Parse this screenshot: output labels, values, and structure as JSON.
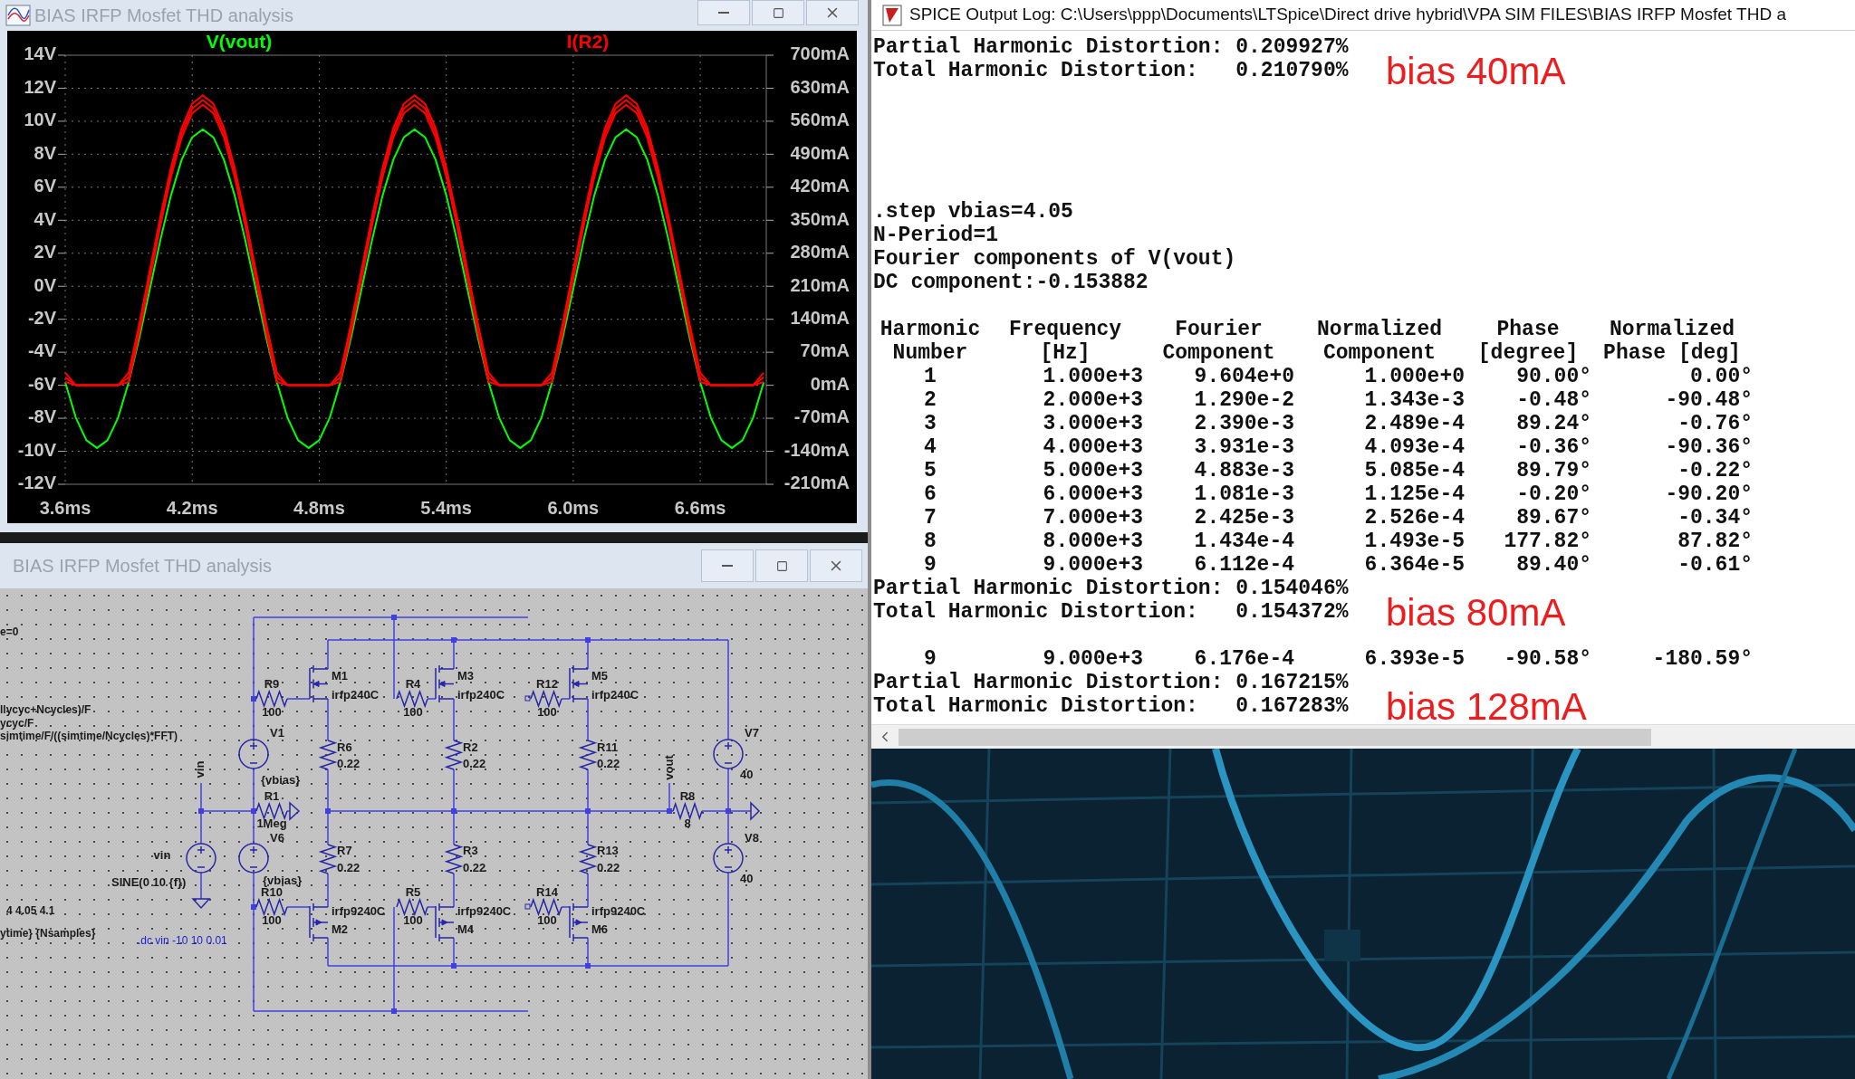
{
  "plot_window": {
    "title": "BIAS IRFP Mosfet THD analysis",
    "chart_data": {
      "type": "line",
      "grid": true,
      "xlim": [
        3.6,
        6.912
      ],
      "ylim": [
        -12,
        14
      ],
      "y2lim": [
        -210,
        700
      ],
      "xticks": [
        {
          "value": 3.6,
          "label": "3.6ms"
        },
        {
          "value": 4.2,
          "label": "4.2ms"
        },
        {
          "value": 4.8,
          "label": "4.8ms"
        },
        {
          "value": 5.4,
          "label": "5.4ms"
        },
        {
          "value": 6.0,
          "label": "6.0ms"
        },
        {
          "value": 6.6,
          "label": "6.6ms"
        }
      ],
      "yticks": [
        {
          "value": 14,
          "label": "14V"
        },
        {
          "value": 12,
          "label": "12V"
        },
        {
          "value": 10,
          "label": "10V"
        },
        {
          "value": 8,
          "label": "8V"
        },
        {
          "value": 6,
          "label": "6V"
        },
        {
          "value": 4,
          "label": "4V"
        },
        {
          "value": 2,
          "label": "2V"
        },
        {
          "value": 0,
          "label": "0V"
        },
        {
          "value": -2,
          "label": "-2V"
        },
        {
          "value": -4,
          "label": "-4V"
        },
        {
          "value": -6,
          "label": "-6V"
        },
        {
          "value": -8,
          "label": "-8V"
        },
        {
          "value": -10,
          "label": "-10V"
        },
        {
          "value": -12,
          "label": "-12V"
        }
      ],
      "y2ticks": [
        {
          "value": 700,
          "label": "700mA"
        },
        {
          "value": 630,
          "label": "630mA"
        },
        {
          "value": 560,
          "label": "560mA"
        },
        {
          "value": 490,
          "label": "490mA"
        },
        {
          "value": 420,
          "label": "420mA"
        },
        {
          "value": 350,
          "label": "350mA"
        },
        {
          "value": 280,
          "label": "280mA"
        },
        {
          "value": 210,
          "label": "210mA"
        },
        {
          "value": 140,
          "label": "140mA"
        },
        {
          "value": 70,
          "label": "70mA"
        },
        {
          "value": 0,
          "label": "0mA"
        },
        {
          "value": -70,
          "label": "-70mA"
        },
        {
          "value": -140,
          "label": "-140mA"
        },
        {
          "value": -210,
          "label": "-210mA"
        }
      ],
      "x": [
        3.6,
        3.65,
        3.7,
        3.75,
        3.8,
        3.85,
        3.9,
        3.95,
        4.0,
        4.05,
        4.1,
        4.15,
        4.2,
        4.25,
        4.3,
        4.35,
        4.4,
        4.45,
        4.5,
        4.55,
        4.6,
        4.65,
        4.7,
        4.75,
        4.8,
        4.85,
        4.9,
        4.95,
        5.0,
        5.05,
        5.1,
        5.15,
        5.2,
        5.25,
        5.3,
        5.35,
        5.4,
        5.45,
        5.5,
        5.55,
        5.6,
        5.65,
        5.7,
        5.75,
        5.8,
        5.85,
        5.9,
        5.95,
        6.0,
        6.05,
        6.1,
        6.15,
        6.2,
        6.25,
        6.3,
        6.35,
        6.4,
        6.45,
        6.5,
        6.55,
        6.6,
        6.65,
        6.7,
        6.75,
        6.8,
        6.85,
        6.9
      ],
      "series": [
        {
          "name": "V(vout)",
          "color": "#00ff00",
          "values": [
            -5.82,
            -7.96,
            -9.33,
            -9.8,
            -9.33,
            -7.96,
            -5.82,
            -3.13,
            -0.15,
            2.83,
            5.52,
            7.66,
            9.03,
            9.5,
            9.03,
            7.66,
            5.52,
            2.83,
            -0.15,
            -3.13,
            -5.82,
            -7.96,
            -9.33,
            -9.8,
            -9.33,
            -7.96,
            -5.82,
            -3.13,
            -0.15,
            2.83,
            5.52,
            7.66,
            9.03,
            9.5,
            9.03,
            7.66,
            5.52,
            2.83,
            -0.15,
            -3.13,
            -5.82,
            -7.96,
            -9.33,
            -9.8,
            -9.33,
            -7.96,
            -5.82,
            -3.13,
            -0.15,
            2.83,
            5.52,
            7.66,
            9.03,
            9.5,
            9.03,
            7.66,
            5.52,
            2.83,
            -0.15,
            -3.13,
            -5.82,
            -7.96,
            -9.33,
            -9.8,
            -9.33,
            -7.96,
            -5.82
          ]
        },
        {
          "name": "I(R2)",
          "color": "#ff0000",
          "axis": "y2",
          "values": [
            7,
            0,
            0,
            0,
            0,
            0,
            7,
            110,
            225,
            339,
            442,
            525,
            577,
            595,
            577,
            525,
            442,
            339,
            225,
            110,
            7,
            0,
            0,
            0,
            0,
            0,
            7,
            110,
            225,
            339,
            442,
            525,
            577,
            595,
            577,
            525,
            442,
            339,
            225,
            110,
            7,
            0,
            0,
            0,
            0,
            0,
            7,
            110,
            225,
            339,
            442,
            525,
            577,
            595,
            577,
            525,
            442,
            339,
            225,
            110,
            7,
            0,
            0,
            0,
            0,
            0,
            7
          ]
        },
        {
          "color": "#ff0000",
          "axis": "y2",
          "values": [
            17,
            0,
            0,
            0,
            0,
            0,
            17,
            120,
            235,
            349,
            452,
            535,
            587,
            605,
            587,
            535,
            452,
            349,
            235,
            120,
            17,
            0,
            0,
            0,
            0,
            0,
            17,
            120,
            235,
            349,
            452,
            535,
            587,
            605,
            587,
            535,
            452,
            349,
            235,
            120,
            17,
            0,
            0,
            0,
            0,
            0,
            17,
            120,
            235,
            349,
            452,
            535,
            587,
            605,
            587,
            535,
            452,
            349,
            235,
            120,
            17,
            0,
            0,
            0,
            0,
            0,
            17
          ]
        },
        {
          "color": "#ff0000",
          "axis": "y2",
          "values": [
            27,
            0,
            0,
            0,
            0,
            0,
            27,
            130,
            245,
            359,
            462,
            545,
            597,
            615,
            597,
            545,
            462,
            359,
            245,
            130,
            27,
            0,
            0,
            0,
            0,
            0,
            27,
            130,
            245,
            359,
            462,
            545,
            597,
            615,
            597,
            545,
            462,
            359,
            245,
            130,
            27,
            0,
            0,
            0,
            0,
            0,
            27,
            130,
            245,
            359,
            462,
            545,
            597,
            615,
            597,
            545,
            462,
            359,
            245,
            130,
            27,
            0,
            0,
            0,
            0,
            0,
            27
          ]
        }
      ]
    }
  },
  "schematic_window": {
    "title": "BIAS IRFP Mosfet THD analysis",
    "directives": [
      {
        "kind": "directive",
        "text": "e=0"
      },
      {
        "kind": "directive",
        "text": "llycyc+Ncycles)/F"
      },
      {
        "kind": "directive",
        "text": "ycyc/F"
      },
      {
        "kind": "directive",
        "text": "simtime/F/((simtime/Ncycles)*FFT)"
      },
      {
        "kind": "directive",
        "text": "4 4.05 4.1"
      },
      {
        "kind": "directive",
        "text": "ytime} {Nsamples}"
      },
      {
        "kind": "comment",
        "text": ".dc vin -10 10 0.01"
      }
    ],
    "components": [
      {
        "kind": "resistor",
        "ref": "R9",
        "value": "100"
      },
      {
        "kind": "mosfet",
        "ref": "M1",
        "value": "irfp240C"
      },
      {
        "kind": "resistor",
        "ref": "R4",
        "value": "100"
      },
      {
        "kind": "mosfet",
        "ref": "M3",
        "value": "irfp240C"
      },
      {
        "kind": "resistor",
        "ref": "R12",
        "value": "100"
      },
      {
        "kind": "mosfet",
        "ref": "M5",
        "value": "irfp240C"
      },
      {
        "kind": "source",
        "ref": "V1",
        "value": "{vbias}"
      },
      {
        "kind": "resistor",
        "ref": "R6",
        "value": "0.22"
      },
      {
        "kind": "resistor",
        "ref": "R2",
        "value": "0.22"
      },
      {
        "kind": "resistor",
        "ref": "R11",
        "value": "0.22"
      },
      {
        "kind": "source",
        "ref": "V7",
        "value": "40"
      },
      {
        "kind": "resistor",
        "ref": "R1",
        "value": "1Meg"
      },
      {
        "kind": "resistor",
        "ref": "R8",
        "value": "8"
      },
      {
        "kind": "source",
        "ref": "vin",
        "value": "SINE(0 10 {f})"
      },
      {
        "kind": "source",
        "ref": "V6",
        "value": "{vbias}"
      },
      {
        "kind": "resistor",
        "ref": "R7",
        "value": "0.22"
      },
      {
        "kind": "resistor",
        "ref": "R3",
        "value": "0.22"
      },
      {
        "kind": "resistor",
        "ref": "R13",
        "value": "0.22"
      },
      {
        "kind": "source",
        "ref": "V8",
        "value": "40"
      },
      {
        "kind": "resistor",
        "ref": "R10",
        "value": "100"
      },
      {
        "kind": "mosfet",
        "ref": "M2",
        "value": "irfp9240C"
      },
      {
        "kind": "resistor",
        "ref": "R5",
        "value": "100"
      },
      {
        "kind": "mosfet",
        "ref": "M4",
        "value": "irfp9240C"
      },
      {
        "kind": "resistor",
        "ref": "R14",
        "value": "100"
      },
      {
        "kind": "mosfet",
        "ref": "M6",
        "value": "irfp9240C"
      }
    ],
    "net_labels": [
      "vin",
      "vout"
    ]
  },
  "log_window": {
    "title": "SPICE Output Log: C:\\Users\\ppp\\Documents\\LTSpice\\Direct drive hybrid\\VPA SIM FILES\\BIAS IRFP Mosfet THD a",
    "lines": [
      {
        "kind": "text",
        "text": "Partial Harmonic Distortion: 0.209927%"
      },
      {
        "kind": "text",
        "text": "Total Harmonic Distortion:   0.210790%",
        "note": "bias 40mA"
      },
      {
        "kind": "blank"
      },
      {
        "kind": "blank"
      },
      {
        "kind": "blank"
      },
      {
        "kind": "blank"
      },
      {
        "kind": "blank"
      },
      {
        "kind": "text",
        "text": ".step vbias=4.05"
      },
      {
        "kind": "text",
        "text": "N-Period=1"
      },
      {
        "kind": "text",
        "text": "Fourier components of V(vout)"
      },
      {
        "kind": "text",
        "text": "DC component:-0.153882"
      },
      {
        "kind": "blank"
      },
      {
        "kind": "header",
        "cells": [
          [
            "Harmonic",
            "Number"
          ],
          [
            "Frequency",
            "[Hz]"
          ],
          [
            "Fourier",
            "Component"
          ],
          [
            "Normalized",
            "Component"
          ],
          [
            "Phase",
            "[degree]"
          ],
          [
            "Normalized",
            "Phase [deg]"
          ]
        ]
      },
      {
        "kind": "row",
        "cells": [
          "1",
          "1.000e+3",
          "9.604e+0",
          "1.000e+0",
          "90.00°",
          "0.00°"
        ]
      },
      {
        "kind": "row",
        "cells": [
          "2",
          "2.000e+3",
          "1.290e-2",
          "1.343e-3",
          "-0.48°",
          "-90.48°"
        ]
      },
      {
        "kind": "row",
        "cells": [
          "3",
          "3.000e+3",
          "2.390e-3",
          "2.489e-4",
          "89.24°",
          "-0.76°"
        ]
      },
      {
        "kind": "row",
        "cells": [
          "4",
          "4.000e+3",
          "3.931e-3",
          "4.093e-4",
          "-0.36°",
          "-90.36°"
        ]
      },
      {
        "kind": "row",
        "cells": [
          "5",
          "5.000e+3",
          "4.883e-3",
          "5.085e-4",
          "89.79°",
          "-0.22°"
        ]
      },
      {
        "kind": "row",
        "cells": [
          "6",
          "6.000e+3",
          "1.081e-3",
          "1.125e-4",
          "-0.20°",
          "-90.20°"
        ]
      },
      {
        "kind": "row",
        "cells": [
          "7",
          "7.000e+3",
          "2.425e-3",
          "2.526e-4",
          "89.67°",
          "-0.34°"
        ]
      },
      {
        "kind": "row",
        "cells": [
          "8",
          "8.000e+3",
          "1.434e-4",
          "1.493e-5",
          "177.82°",
          "87.82°"
        ]
      },
      {
        "kind": "row",
        "cells": [
          "9",
          "9.000e+3",
          "6.112e-4",
          "6.364e-5",
          "89.40°",
          "-0.61°"
        ]
      },
      {
        "kind": "text",
        "text": "Partial Harmonic Distortion: 0.154046%"
      },
      {
        "kind": "text",
        "text": "Total Harmonic Distortion:   0.154372%",
        "note": "bias 80mA"
      },
      {
        "kind": "blank"
      },
      {
        "kind": "row",
        "cells": [
          "9",
          "9.000e+3",
          "6.176e-4",
          "6.393e-5",
          "-90.58°",
          "-180.59°"
        ]
      },
      {
        "kind": "text",
        "text": "Partial Harmonic Distortion: 0.167215%"
      },
      {
        "kind": "text",
        "text": "Total Harmonic Distortion:   0.167283%",
        "note": "bias 128mA"
      }
    ]
  }
}
